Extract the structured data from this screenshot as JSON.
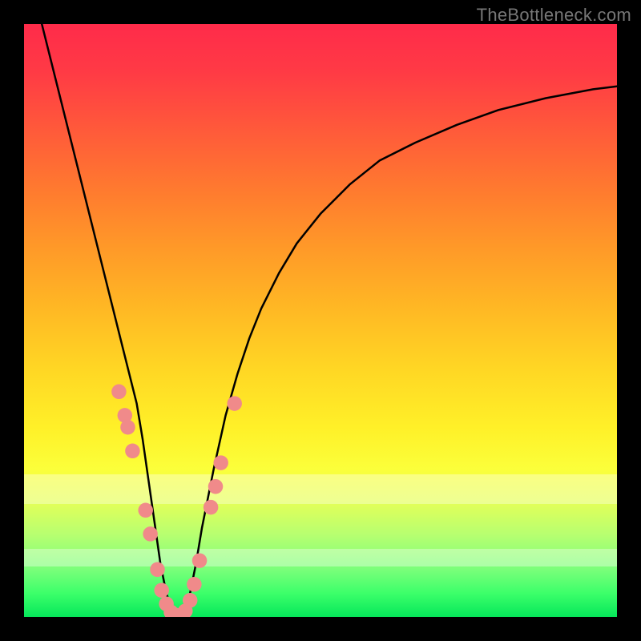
{
  "watermark": "TheBottleneck.com",
  "chart_data": {
    "type": "line",
    "title": "",
    "xlabel": "",
    "ylabel": "",
    "xlim": [
      0,
      100
    ],
    "ylim": [
      0,
      100
    ],
    "grid": false,
    "legend": false,
    "series": [
      {
        "name": "curve",
        "color": "#000000",
        "x": [
          3,
          5,
          7,
          9,
          11,
          13,
          15,
          17,
          19,
          20,
          21,
          22,
          23,
          24,
          25,
          26,
          27,
          28,
          29,
          30,
          32,
          34,
          36,
          38,
          40,
          43,
          46,
          50,
          55,
          60,
          66,
          73,
          80,
          88,
          96,
          100
        ],
        "y": [
          100,
          92,
          84,
          76,
          68,
          60,
          52,
          44,
          36,
          30,
          23,
          16,
          9,
          4,
          1,
          0,
          1,
          4,
          9,
          15,
          25,
          34,
          41,
          47,
          52,
          58,
          63,
          68,
          73,
          77,
          80,
          83,
          85.5,
          87.5,
          89,
          89.5
        ]
      }
    ],
    "markers": {
      "name": "dots",
      "color": "#f08a8a",
      "radius_plot_units": 1.25,
      "points": [
        {
          "x": 16.0,
          "y": 38.0
        },
        {
          "x": 17.0,
          "y": 34.0
        },
        {
          "x": 17.5,
          "y": 32.0
        },
        {
          "x": 18.3,
          "y": 28.0
        },
        {
          "x": 20.5,
          "y": 18.0
        },
        {
          "x": 21.3,
          "y": 14.0
        },
        {
          "x": 22.5,
          "y": 8.0
        },
        {
          "x": 23.2,
          "y": 4.5
        },
        {
          "x": 24.0,
          "y": 2.2
        },
        {
          "x": 24.8,
          "y": 0.8
        },
        {
          "x": 25.6,
          "y": 0.3
        },
        {
          "x": 26.4,
          "y": 0.3
        },
        {
          "x": 27.2,
          "y": 1.0
        },
        {
          "x": 28.0,
          "y": 2.8
        },
        {
          "x": 28.7,
          "y": 5.5
        },
        {
          "x": 29.6,
          "y": 9.5
        },
        {
          "x": 31.5,
          "y": 18.5
        },
        {
          "x": 32.3,
          "y": 22.0
        },
        {
          "x": 33.2,
          "y": 26.0
        },
        {
          "x": 35.5,
          "y": 36.0
        }
      ]
    },
    "light_bands_y": [
      {
        "from": 19,
        "to": 24
      },
      {
        "from": 8.5,
        "to": 11.5
      }
    ],
    "background_gradient": {
      "top": "#ff2b4a",
      "bottom": "#06e75a"
    }
  }
}
